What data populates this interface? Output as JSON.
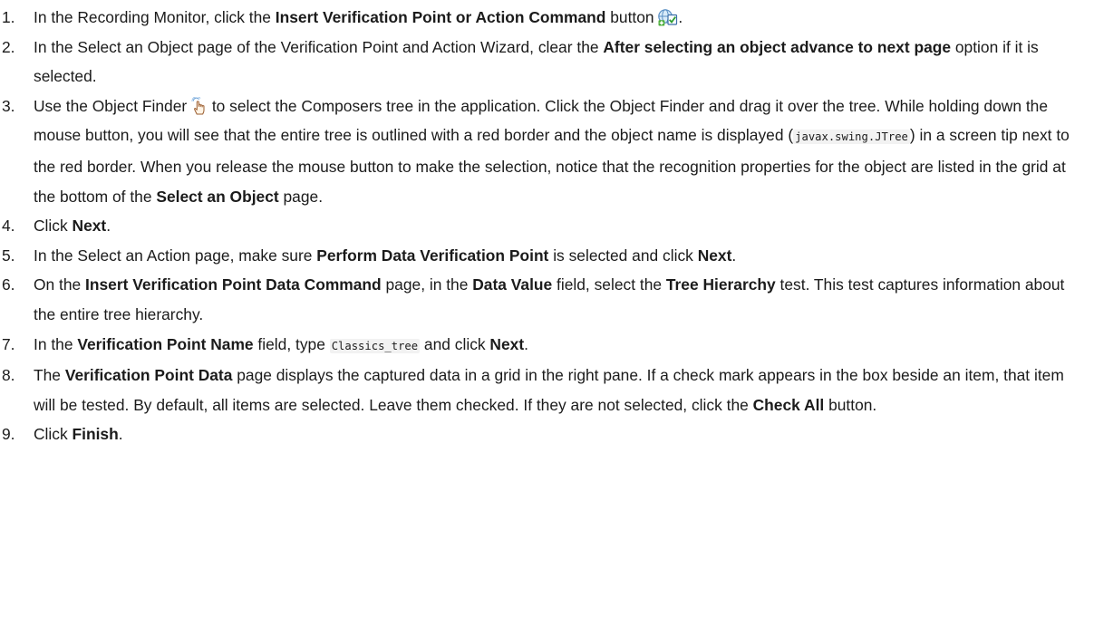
{
  "steps": [
    {
      "num": "1.",
      "t1": "In the Recording Monitor, click the ",
      "b1": "Insert Verification Point or Action Command",
      "t2": " button ",
      "icon": "insert-verification-point-icon",
      "t3": "."
    },
    {
      "num": "2.",
      "t1": "In the Select an Object page of the Verification Point and Action Wizard, clear the ",
      "b1": "After selecting an object advance to next page",
      "t2": " option if it is selected."
    },
    {
      "num": "3.",
      "t1": "Use the Object Finder ",
      "icon": "object-finder-hand-icon",
      "t2": " to select the Composers tree in the application. Click the Object Finder and drag it over the tree. While holding down the mouse button, you will see that the entire tree is outlined with a red border and the object name is displayed (",
      "code1": "javax.swing.JTree",
      "t3": ") in a screen tip next to the red border. When you release the mouse button to make the selection, notice that the recognition properties for the object are listed in the grid at the bottom of the ",
      "b1": "Select an Object",
      "t4": " page."
    },
    {
      "num": "4.",
      "t1": "Click ",
      "b1": "Next",
      "t2": "."
    },
    {
      "num": "5.",
      "t1": "In the Select an Action page, make sure ",
      "b1": "Perform Data Verification Point",
      "t2": " is selected and click ",
      "b2": "Next",
      "t3": "."
    },
    {
      "num": "6.",
      "t1": "On the ",
      "b1": "Insert Verification Point Data Command",
      "t2": " page, in the ",
      "b2": "Data Value",
      "t3": " field, select the ",
      "b3": "Tree Hierarchy",
      "t4": " test. This test captures information about the entire tree hierarchy."
    },
    {
      "num": "7.",
      "t1": "In the ",
      "b1": "Verification Point Name",
      "t2": " field, type ",
      "code1": "Classics_tree",
      "t3": " and click ",
      "b2": "Next",
      "t4": "."
    },
    {
      "num": "8.",
      "t1": "The ",
      "b1": "Verification Point Data",
      "t2": " page displays the captured data in a grid in the right pane. If a check mark appears in the box beside an item, that item will be tested. By default, all items are selected. Leave them checked. If they are not selected, click the ",
      "b2": "Check All",
      "t3": " button."
    },
    {
      "num": "9.",
      "t1": "Click ",
      "b1": "Finish",
      "t2": "."
    }
  ]
}
